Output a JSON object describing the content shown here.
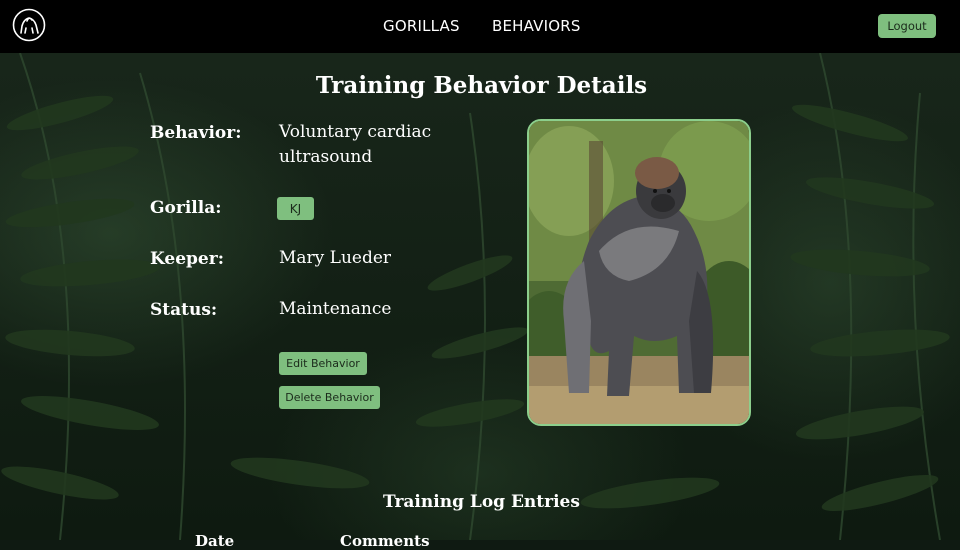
{
  "nav": {
    "links": [
      "GORILLAS",
      "BEHAVIORS"
    ],
    "logout_label": "Logout",
    "logo_icon": "gorilla-icon"
  },
  "page": {
    "title": "Training Behavior Details"
  },
  "details": {
    "behavior_label": "Behavior:",
    "behavior_value_line1": "Voluntary cardiac",
    "behavior_value_line2": "ultrasound",
    "gorilla_label": "Gorilla:",
    "gorilla_value": "KJ",
    "keeper_label": "Keeper:",
    "keeper_value": "Mary Lueder",
    "status_label": "Status:",
    "status_value": "Maintenance"
  },
  "actions": {
    "edit_label": "Edit Behavior",
    "delete_label": "Delete Behavior"
  },
  "log": {
    "title": "Training Log Entries",
    "columns": [
      "Date",
      "Comments"
    ]
  },
  "colors": {
    "accent": "#7fbf7f",
    "photo_border": "#8ccf8c",
    "navbar": "#000000"
  }
}
